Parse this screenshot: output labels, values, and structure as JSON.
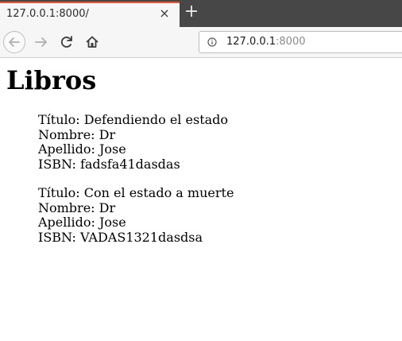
{
  "browser": {
    "tab_title": "127.0.0.1:8000/",
    "tab_close_glyph": "×",
    "new_tab_glyph": "+",
    "url_host": "127.0.0.1",
    "url_port": ":8000",
    "accent_color": "#e4572e",
    "icons": {
      "back": "back-arrow-icon",
      "forward": "forward-arrow-icon",
      "reload": "reload-icon",
      "home": "home-icon",
      "info": "info-icon"
    }
  },
  "page": {
    "title": "Libros",
    "books": [
      {
        "titulo": "Título: Defendiendo el estado",
        "nombre": "Nombre: Dr",
        "apellido": "Apellido: Jose",
        "isbn": "ISBN: fadsfa41dasdas"
      },
      {
        "titulo": "Título: Con el estado a muerte",
        "nombre": "Nombre: Dr",
        "apellido": "Apellido: Jose",
        "isbn": "ISBN: VADAS1321dasdsa"
      }
    ]
  }
}
